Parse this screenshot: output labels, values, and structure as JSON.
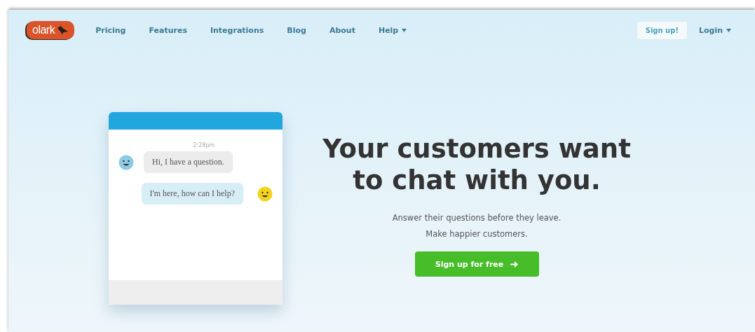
{
  "logo": {
    "text": "olark"
  },
  "nav": [
    {
      "label": "Pricing",
      "dropdown": false
    },
    {
      "label": "Features",
      "dropdown": false
    },
    {
      "label": "Integrations",
      "dropdown": false
    },
    {
      "label": "Blog",
      "dropdown": false
    },
    {
      "label": "About",
      "dropdown": false
    },
    {
      "label": "Help",
      "dropdown": true
    }
  ],
  "signup_button": "Sign up!",
  "login": {
    "label": "Login",
    "dropdown": true
  },
  "chat": {
    "timestamp": "2:28pm",
    "messages": [
      {
        "text": "Hi, I have a question.",
        "kind": "visitor"
      },
      {
        "text": "I'm here, how can I help?",
        "kind": "operator"
      }
    ]
  },
  "hero": {
    "title": "Your customers want to chat with you.",
    "lines": [
      "Answer their questions before they leave.",
      "Make happier customers."
    ],
    "cta": "Sign up for free"
  }
}
